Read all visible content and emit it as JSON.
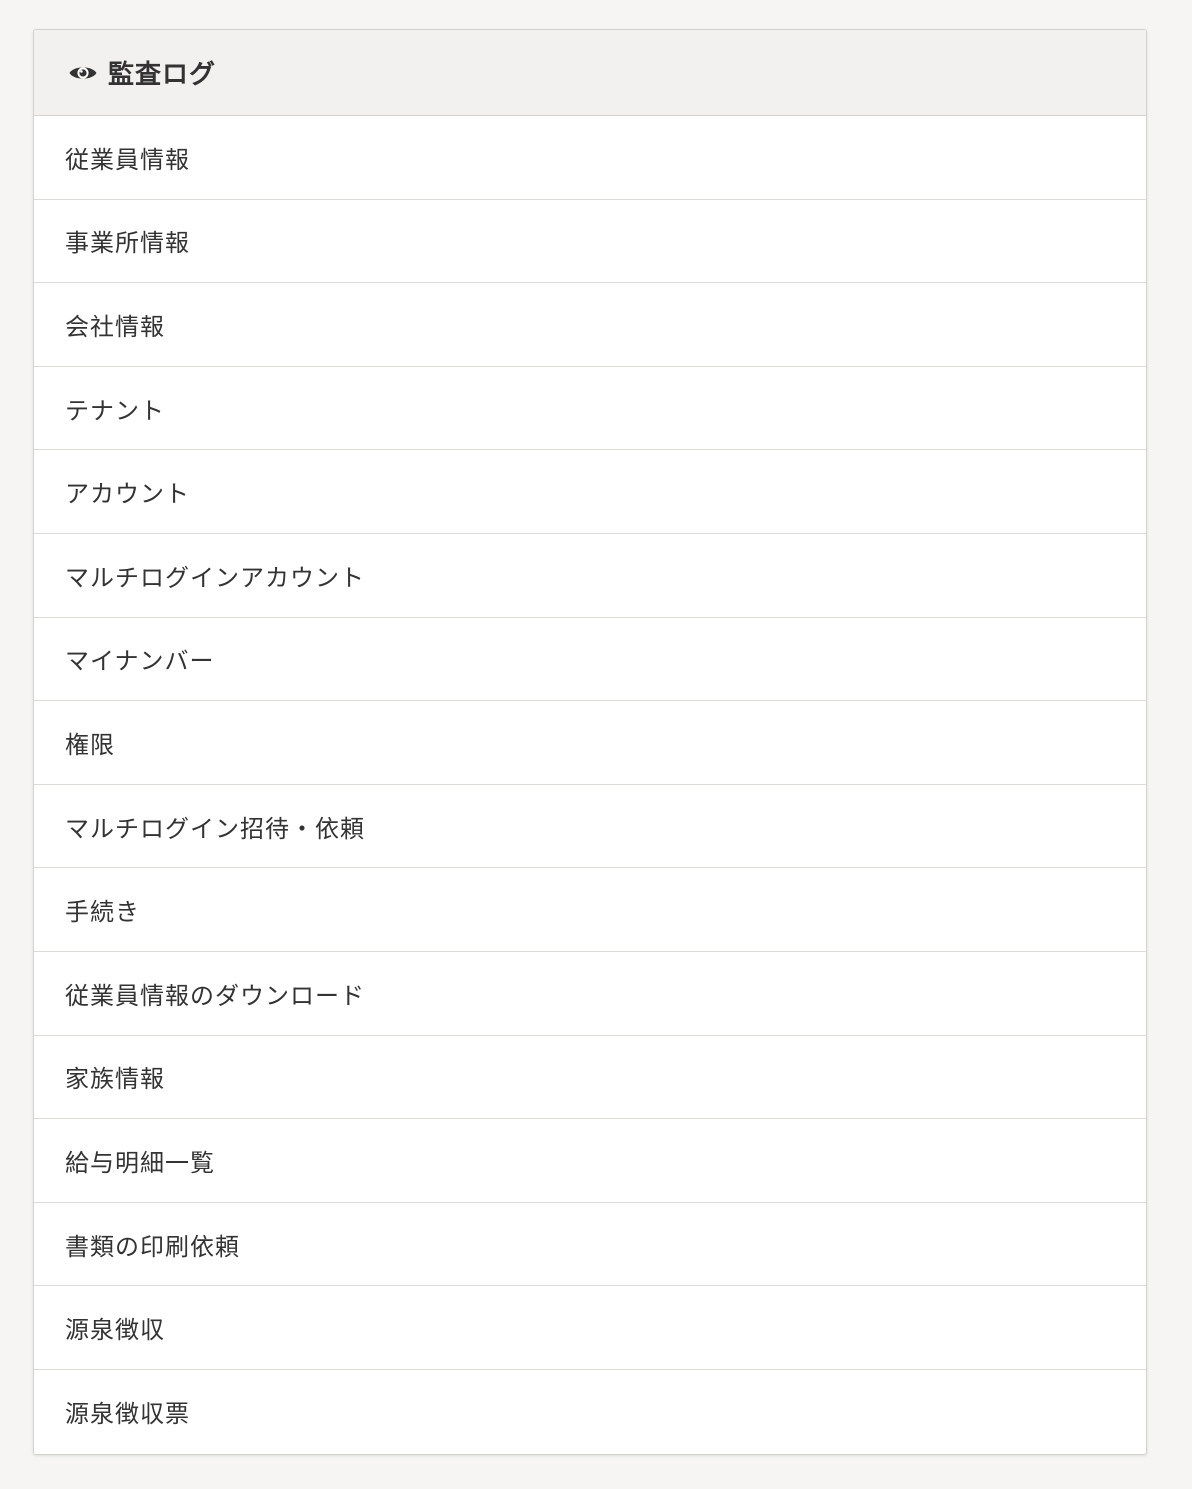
{
  "panel": {
    "title": "監査ログ",
    "title_icon": "eye-icon",
    "items": [
      {
        "label": "従業員情報"
      },
      {
        "label": "事業所情報"
      },
      {
        "label": "会社情報"
      },
      {
        "label": "テナント"
      },
      {
        "label": "アカウント"
      },
      {
        "label": "マルチログインアカウント"
      },
      {
        "label": "マイナンバー"
      },
      {
        "label": "権限"
      },
      {
        "label": "マルチログイン招待・依頼"
      },
      {
        "label": "手続き"
      },
      {
        "label": "従業員情報のダウンロード"
      },
      {
        "label": "家族情報"
      },
      {
        "label": "給与明細一覧"
      },
      {
        "label": "書類の印刷依頼"
      },
      {
        "label": "源泉徴収"
      },
      {
        "label": "源泉徴収票"
      }
    ]
  },
  "colors": {
    "page_background": "#f6f5f3",
    "header_background": "#f2f1ef",
    "text": "#333333",
    "border": "#d4d2cf"
  }
}
